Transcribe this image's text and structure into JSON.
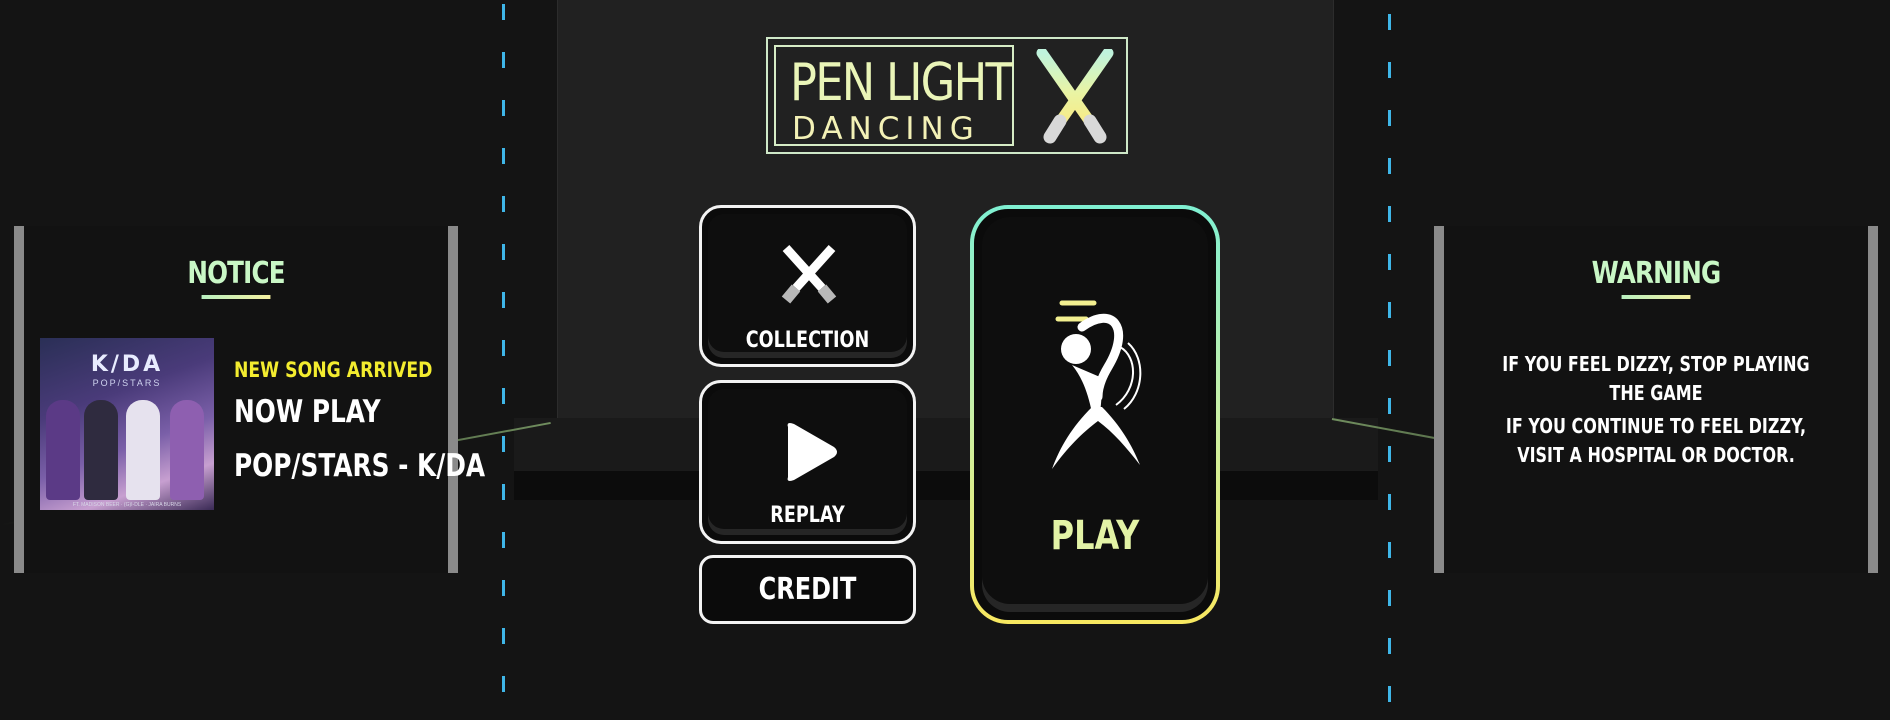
{
  "logo": {
    "line1": "PEN LIGHT",
    "line2": "DANCING"
  },
  "notice": {
    "title": "NOTICE",
    "album": {
      "logo_text": "K/DA",
      "subtitle": "POP/STARS",
      "credits": "FT. MADISON BEER · (G)I-DLE · JAIRA BURNS"
    },
    "new_song_label": "NEW SONG ARRIVED",
    "now_play_label": "NOW PLAY",
    "song_name": "POP/STARS - K/DA"
  },
  "warning": {
    "title": "WARNING",
    "line1": "IF YOU FEEL DIZZY, STOP PLAYING THE GAME",
    "line2": "IF YOU CONTINUE TO FEEL DIZZY,",
    "line3": "VISIT A HOSPITAL OR DOCTOR."
  },
  "menu": {
    "collection_label": "COLLECTION",
    "replay_label": "REPLAY",
    "credit_label": "CREDIT",
    "play_label": "PLAY"
  },
  "colors": {
    "notice_title": "#c9f7c6",
    "new_song": "#f3ec2f",
    "lane": "#44c8ff",
    "play_gradient_top": "#7ff0d2",
    "play_gradient_bottom": "#f8e860"
  },
  "icons": {
    "logo": "crossed-penlights-icon",
    "collection": "crossed-sticks-icon",
    "replay": "play-triangle-icon",
    "play": "dancer-icon"
  }
}
